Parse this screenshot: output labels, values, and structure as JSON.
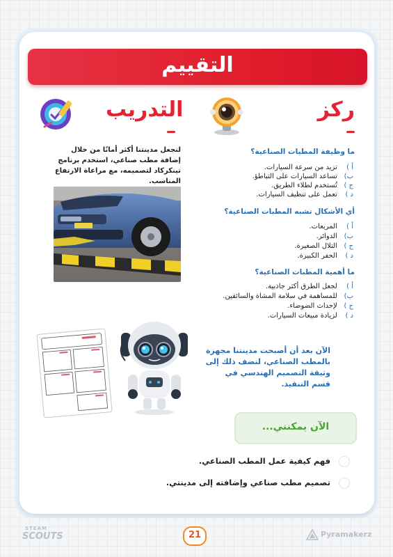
{
  "banner": {
    "title": "التقييم"
  },
  "sections": {
    "focus_title": "ركز",
    "training_title": "التدريب"
  },
  "training": {
    "description": "لنجعل مدينتنا أكثر أمانًا من خلال إضافة مطب صناعي، استخدم برنامج تينكركاد لتصميمه، مع مراعاة الارتفاع المناسب."
  },
  "questions": [
    {
      "q": "ما وظيفة المطبات الصناعية؟",
      "options": [
        {
          "letter": "أ )",
          "text": "تزيد من سرعة السيارات."
        },
        {
          "letter": "ب)",
          "text": "تساعد السيارات على التباطؤ."
        },
        {
          "letter": "ج )",
          "text": "تُستخدم لطلاء الطريق."
        },
        {
          "letter": "د )",
          "text": "تعمل على تنظيف السيارات."
        }
      ]
    },
    {
      "q": "أي الأشكال تشبه المطبات الصناعية؟",
      "options": [
        {
          "letter": "أ )",
          "text": "المربعات."
        },
        {
          "letter": "ب)",
          "text": "الدوائر."
        },
        {
          "letter": "ج )",
          "text": "التلال الصغيرة."
        },
        {
          "letter": "د )",
          "text": "الحفر الكبيرة."
        }
      ]
    },
    {
      "q": "ما أهمية المطبات الصناعية؟",
      "options": [
        {
          "letter": "أ )",
          "text": "لجعل الطرق أكثر جاذبية."
        },
        {
          "letter": "ب)",
          "text": "للمساهمة في سلامة المشاة والسائقين."
        },
        {
          "letter": "ج )",
          "text": "لإحداث الضوضاء."
        },
        {
          "letter": "د )",
          "text": "لزيادة مبيعات السيارات."
        }
      ]
    }
  ],
  "closing": {
    "text": "الآن بعد أن أصبحت مدينتنا مجهزة بالمطب الصناعي، لنضف ذلك إلى وثيقة التصميم الهندسي في قسم التنفيذ."
  },
  "now_i_can": {
    "title": "الآن يمكنني...",
    "items": [
      "فهم كيفية عمل المطب الصناعي.",
      "تصميم مطب صناعي وإضافته إلى مدينتي."
    ]
  },
  "footer": {
    "page_number": "21",
    "left_logo": "SCOUTS",
    "left_logo_top": "STEAM",
    "right_logo": "Pyramakerz"
  },
  "colors": {
    "accent_red": "#e52232",
    "accent_blue": "#2a6fb0",
    "accent_green": "#4aa52f"
  },
  "icons": [
    "webcam-icon",
    "edit-icon",
    "robot-illustration",
    "worksheet-illustration"
  ]
}
